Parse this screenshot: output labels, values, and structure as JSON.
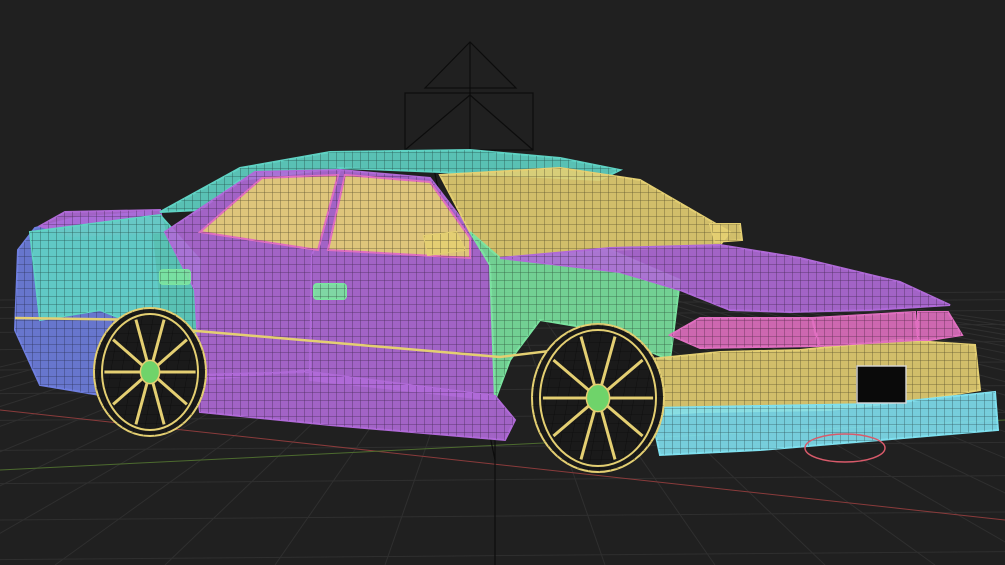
{
  "viewport": {
    "background": "#202020",
    "grid_color": "#2f2f2f",
    "axis_red": "#8a3b3b",
    "axis_green": "#4d6b2f",
    "camera_gizmo_color": "#0c0c0c"
  },
  "wireframe": {
    "palette": {
      "teal": "#5fd3c4",
      "mint": "#7be3a0",
      "purple": "#b06ad8",
      "pink": "#e06fc0",
      "yellow": "#e4cf72",
      "blue": "#6f7fe0",
      "cyan": "#7fe0ef",
      "green": "#6fd36a",
      "red": "#d85a6a"
    }
  }
}
